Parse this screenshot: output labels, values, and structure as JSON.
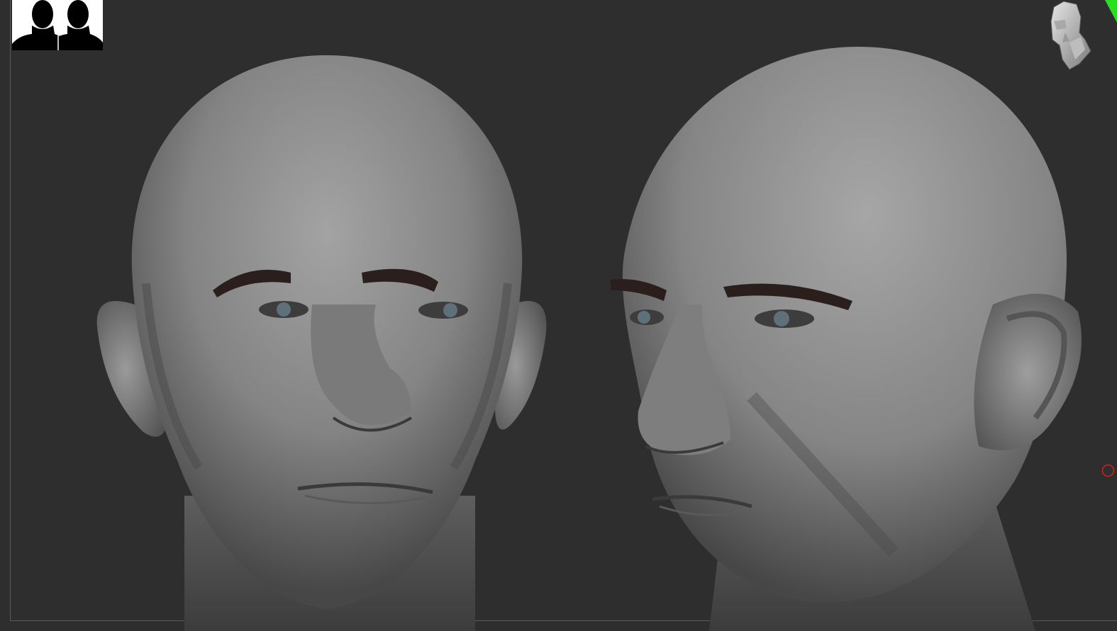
{
  "viewport": {
    "background_color": "#2e2e2e",
    "frame_color": "#5a5a5a"
  },
  "toolbar": {
    "spotlight_icon": "two-heads-silhouette-icon",
    "navigation_icon": "navigation-head-icon",
    "axis_indicator_color": "#29e01f",
    "pivot_marker_color": "#d22222"
  },
  "models": [
    {
      "view": "front",
      "skin_color": "#8a8a8a",
      "brow_color": "#2b1f1d",
      "iris_color": "#5e707a"
    },
    {
      "view": "three-quarter",
      "skin_color": "#8a8a8a",
      "brow_color": "#2b1f1d",
      "iris_color": "#5e707a"
    }
  ]
}
